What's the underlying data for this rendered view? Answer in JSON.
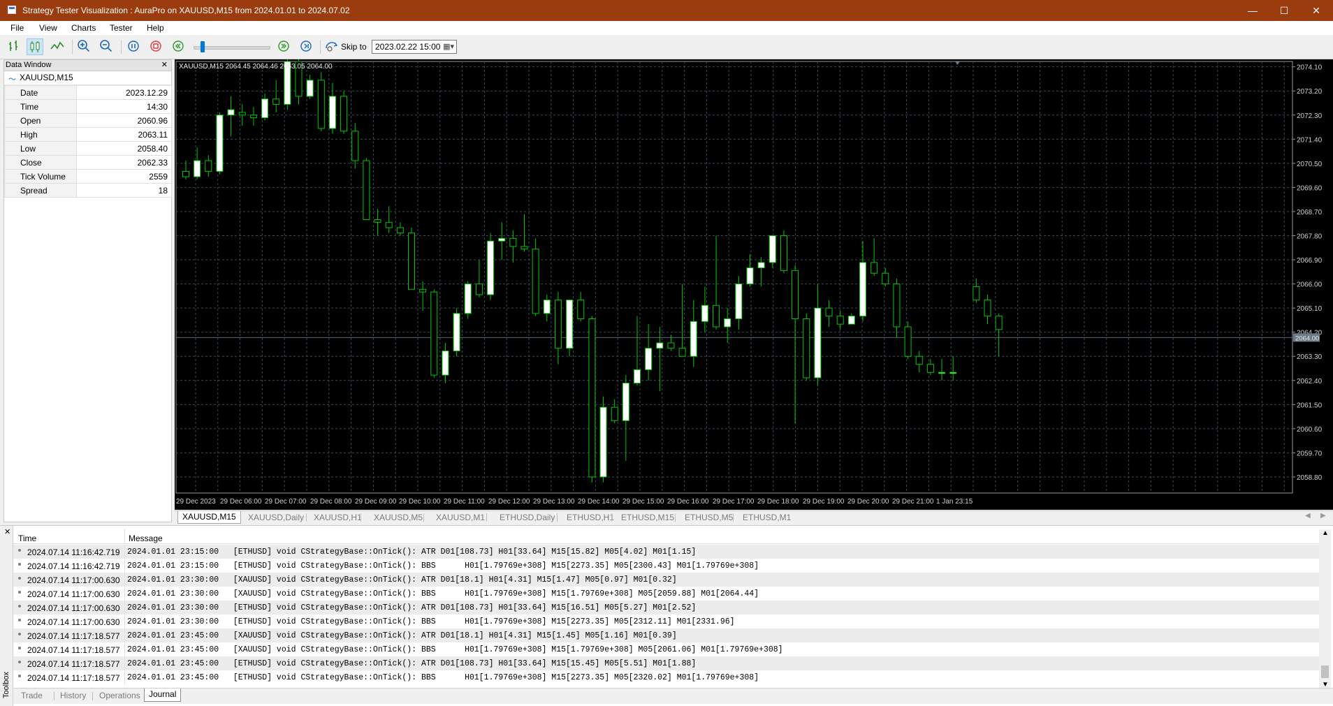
{
  "window": {
    "title": "Strategy Tester Visualization : AuraPro on XAUUSD,M15 from 2024.01.01 to 2024.07.02"
  },
  "menu": [
    "File",
    "View",
    "Charts",
    "Tester",
    "Help"
  ],
  "toolbar": {
    "skip_label": "Skip to",
    "skip_date": "2023.02.22 15:00"
  },
  "data_window": {
    "title": "Data Window",
    "symbol": "XAUUSD,M15",
    "rows": [
      {
        "label": "Date",
        "value": "2023.12.29"
      },
      {
        "label": "Time",
        "value": "14:30"
      },
      {
        "label": "Open",
        "value": "2060.96"
      },
      {
        "label": "High",
        "value": "2063.11"
      },
      {
        "label": "Low",
        "value": "2058.40"
      },
      {
        "label": "Close",
        "value": "2062.33"
      },
      {
        "label": "Tick Volume",
        "value": "2559"
      },
      {
        "label": "Spread",
        "value": "18"
      }
    ]
  },
  "chart_data": {
    "type": "candlestick",
    "symbol_header": "XAUUSD,M15  2064.45 2064.46 2063.05 2064.00",
    "price_axis_labels": [
      "2074.10",
      "2073.20",
      "2072.30",
      "2071.40",
      "2070.50",
      "2069.60",
      "2068.70",
      "2067.80",
      "2066.90",
      "2066.00",
      "2065.10",
      "2064.20",
      "2063.30",
      "2062.40",
      "2061.50",
      "2060.60",
      "2059.70",
      "2058.80"
    ],
    "current_price": "2064.00",
    "time_axis_labels": [
      "29 Dec 2023",
      "29 Dec 06:00",
      "29 Dec 07:00",
      "29 Dec 08:00",
      "29 Dec 09:00",
      "29 Dec 10:00",
      "29 Dec 11:00",
      "29 Dec 12:00",
      "29 Dec 13:00",
      "29 Dec 14:00",
      "29 Dec 15:00",
      "29 Dec 16:00",
      "29 Dec 17:00",
      "29 Dec 18:00",
      "29 Dec 19:00",
      "29 Dec 20:00",
      "29 Dec 21:00",
      "1 Jan 23:15"
    ],
    "ylim": [
      2058.2,
      2074.3
    ],
    "grid": true,
    "candles": [
      [
        2070.2,
        2070.6,
        2069.9,
        2070.0
      ],
      [
        2070.0,
        2071.1,
        2069.9,
        2070.6
      ],
      [
        2070.6,
        2070.8,
        2070.0,
        2070.2
      ],
      [
        2070.2,
        2072.4,
        2070.1,
        2072.3
      ],
      [
        2072.3,
        2073.0,
        2071.5,
        2072.5
      ],
      [
        2072.4,
        2072.7,
        2071.9,
        2072.3
      ],
      [
        2072.3,
        2072.6,
        2071.9,
        2072.2
      ],
      [
        2072.2,
        2073.1,
        2072.1,
        2072.9
      ],
      [
        2072.9,
        2073.6,
        2072.4,
        2072.7
      ],
      [
        2072.7,
        2074.5,
        2072.5,
        2074.3
      ],
      [
        2074.3,
        2074.6,
        2072.7,
        2073.0
      ],
      [
        2073.0,
        2073.8,
        2072.9,
        2073.6
      ],
      [
        2073.6,
        2073.9,
        2071.7,
        2071.8
      ],
      [
        2071.8,
        2073.5,
        2071.6,
        2073.0
      ],
      [
        2073.0,
        2073.2,
        2071.6,
        2071.7
      ],
      [
        2071.7,
        2072.0,
        2070.3,
        2070.6
      ],
      [
        2070.6,
        2070.7,
        2068.4,
        2068.4
      ],
      [
        2068.4,
        2068.8,
        2067.8,
        2068.3
      ],
      [
        2068.3,
        2068.9,
        2067.9,
        2068.1
      ],
      [
        2068.1,
        2068.3,
        2067.8,
        2067.9
      ],
      [
        2067.9,
        2068.1,
        2065.8,
        2065.8
      ],
      [
        2065.8,
        2066.1,
        2065.0,
        2065.7
      ],
      [
        2065.7,
        2065.8,
        2062.5,
        2062.6
      ],
      [
        2062.6,
        2063.8,
        2062.3,
        2063.5
      ],
      [
        2063.5,
        2065.1,
        2063.3,
        2064.9
      ],
      [
        2064.9,
        2066.1,
        2064.7,
        2066.0
      ],
      [
        2066.0,
        2066.9,
        2065.5,
        2065.6
      ],
      [
        2065.6,
        2067.9,
        2065.4,
        2067.6
      ],
      [
        2067.6,
        2068.3,
        2066.9,
        2067.7
      ],
      [
        2067.7,
        2068.0,
        2066.8,
        2067.4
      ],
      [
        2067.4,
        2068.6,
        2067.2,
        2067.3
      ],
      [
        2067.3,
        2067.7,
        2064.8,
        2064.9
      ],
      [
        2064.9,
        2065.6,
        2064.6,
        2065.4
      ],
      [
        2065.4,
        2065.7,
        2063.0,
        2063.6
      ],
      [
        2063.6,
        2065.3,
        2063.3,
        2065.4
      ],
      [
        2065.4,
        2065.7,
        2064.6,
        2064.7
      ],
      [
        2064.7,
        2064.8,
        2058.6,
        2058.8
      ],
      [
        2058.8,
        2061.8,
        2058.6,
        2061.4
      ],
      [
        2061.4,
        2061.7,
        2060.8,
        2060.9
      ],
      [
        2060.9,
        2062.6,
        2059.4,
        2062.3
      ],
      [
        2062.3,
        2064.8,
        2062.2,
        2062.8
      ],
      [
        2062.8,
        2064.5,
        2062.4,
        2063.6
      ],
      [
        2063.6,
        2064.4,
        2062.0,
        2063.8
      ],
      [
        2063.8,
        2064.1,
        2063.5,
        2063.6
      ],
      [
        2063.6,
        2066.0,
        2063.3,
        2063.3
      ],
      [
        2063.3,
        2065.4,
        2062.9,
        2064.6
      ],
      [
        2064.6,
        2065.9,
        2064.2,
        2065.2
      ],
      [
        2065.2,
        2067.8,
        2064.3,
        2064.4
      ],
      [
        2064.4,
        2065.1,
        2063.8,
        2064.7
      ],
      [
        2064.7,
        2066.3,
        2064.3,
        2066.0
      ],
      [
        2066.0,
        2067.1,
        2065.9,
        2066.6
      ],
      [
        2066.6,
        2067.0,
        2065.9,
        2066.8
      ],
      [
        2066.8,
        2067.7,
        2066.6,
        2067.8
      ],
      [
        2067.8,
        2068.0,
        2066.4,
        2066.5
      ],
      [
        2066.5,
        2066.7,
        2060.8,
        2064.7
      ],
      [
        2064.7,
        2064.9,
        2062.4,
        2062.5
      ],
      [
        2062.5,
        2066.0,
        2062.2,
        2065.1
      ],
      [
        2065.1,
        2065.4,
        2064.4,
        2064.8
      ],
      [
        2064.8,
        2065.0,
        2064.3,
        2064.5
      ],
      [
        2064.5,
        2064.9,
        2064.5,
        2064.8
      ],
      [
        2064.8,
        2067.6,
        2064.6,
        2066.8
      ],
      [
        2066.8,
        2067.7,
        2066.3,
        2066.4
      ],
      [
        2066.4,
        2066.6,
        2065.9,
        2066.0
      ],
      [
        2066.0,
        2066.2,
        2064.0,
        2064.4
      ],
      [
        2064.4,
        2064.6,
        2063.2,
        2063.3
      ],
      [
        2063.3,
        2063.5,
        2062.7,
        2063.0
      ],
      [
        2063.0,
        2063.2,
        2062.6,
        2062.7
      ],
      [
        2062.7,
        2063.2,
        2062.4,
        2062.7
      ],
      [
        2062.7,
        2063.3,
        2062.4,
        2062.7
      ],
      [
        2065.9,
        2066.2,
        2065.3,
        2065.4
      ],
      [
        2065.4,
        2065.6,
        2064.5,
        2064.8
      ],
      [
        2064.8,
        2064.9,
        2063.3,
        2064.3
      ]
    ]
  },
  "chart_tabs": [
    "XAUUSD,M15",
    "XAUUSD,Daily",
    "XAUUSD,H1",
    "XAUUSD,M5",
    "XAUUSD,M1",
    "ETHUSD,Daily",
    "ETHUSD,H1",
    "ETHUSD,M15",
    "ETHUSD,M5",
    "ETHUSD,M1"
  ],
  "journal": {
    "col_time": "Time",
    "col_message": "Message",
    "rows": [
      {
        "time": "2024.07.14 11:16:42.719",
        "message": "2024.01.01 23:15:00   [ETHUSD] void CStrategyBase::OnTick(): ATR D01[108.73] H01[33.64] M15[15.82] M05[4.02] M01[1.15]"
      },
      {
        "time": "2024.07.14 11:16:42.719",
        "message": "2024.01.01 23:15:00   [ETHUSD] void CStrategyBase::OnTick(): BBS      H01[1.79769e+308] M15[2273.35] M05[2300.43] M01[1.79769e+308]"
      },
      {
        "time": "2024.07.14 11:17:00.630",
        "message": "2024.01.01 23:30:00   [XAUUSD] void CStrategyBase::OnTick(): ATR D01[18.1] H01[4.31] M15[1.47] M05[0.97] M01[0.32]"
      },
      {
        "time": "2024.07.14 11:17:00.630",
        "message": "2024.01.01 23:30:00   [XAUUSD] void CStrategyBase::OnTick(): BBS      H01[1.79769e+308] M15[1.79769e+308] M05[2059.88] M01[2064.44]"
      },
      {
        "time": "2024.07.14 11:17:00.630",
        "message": "2024.01.01 23:30:00   [ETHUSD] void CStrategyBase::OnTick(): ATR D01[108.73] H01[33.64] M15[16.51] M05[5.27] M01[2.52]"
      },
      {
        "time": "2024.07.14 11:17:00.630",
        "message": "2024.01.01 23:30:00   [ETHUSD] void CStrategyBase::OnTick(): BBS      H01[1.79769e+308] M15[2273.35] M05[2312.11] M01[2331.96]"
      },
      {
        "time": "2024.07.14 11:17:18.577",
        "message": "2024.01.01 23:45:00   [XAUUSD] void CStrategyBase::OnTick(): ATR D01[18.1] H01[4.31] M15[1.45] M05[1.16] M01[0.39]"
      },
      {
        "time": "2024.07.14 11:17:18.577",
        "message": "2024.01.01 23:45:00   [XAUUSD] void CStrategyBase::OnTick(): BBS      H01[1.79769e+308] M15[1.79769e+308] M05[2061.06] M01[1.79769e+308]"
      },
      {
        "time": "2024.07.14 11:17:18.577",
        "message": "2024.01.01 23:45:00   [ETHUSD] void CStrategyBase::OnTick(): ATR D01[108.73] H01[33.64] M15[15.45] M05[5.51] M01[1.88]"
      },
      {
        "time": "2024.07.14 11:17:18.577",
        "message": "2024.01.01 23:45:00   [ETHUSD] void CStrategyBase::OnTick(): BBS      H01[1.79769e+308] M15[2273.35] M05[2320.02] M01[1.79769e+308]"
      }
    ]
  },
  "toolbox": {
    "label": "Toolbox",
    "tabs": [
      "Trade",
      "History",
      "Operations",
      "Journal"
    ],
    "active_tab": "Journal"
  },
  "colors": {
    "titlebar": "#9a3c0d",
    "chart_bg": "#000000",
    "candle_bull": "#ffffff",
    "candle_bear": "#000000",
    "wick": "#00c800",
    "grid": "#3a4a5a"
  }
}
